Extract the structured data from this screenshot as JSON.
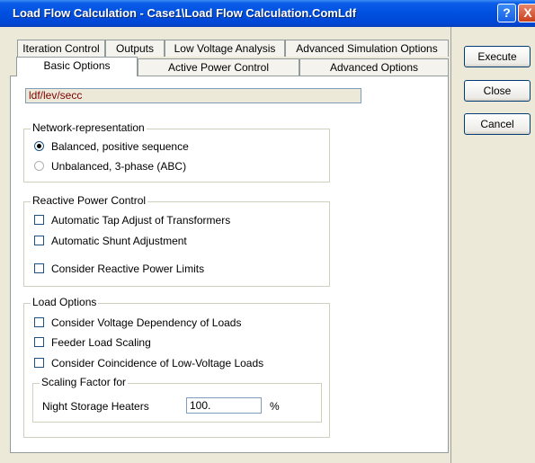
{
  "window": {
    "title": "Load Flow Calculation - Case1\\Load Flow Calculation.ComLdf",
    "help_glyph": "?",
    "close_glyph": "X"
  },
  "tabs": {
    "row_back": [
      "Iteration Control",
      "Outputs",
      "Low Voltage Analysis",
      "Advanced Simulation Options"
    ],
    "row_front": [
      "Basic Options",
      "Active Power Control",
      "Advanced Options"
    ],
    "active": "Basic Options"
  },
  "path_value": "ldf/lev/secc",
  "network": {
    "legend": "Network-representation",
    "options": [
      {
        "label": "Balanced, positive sequence",
        "selected": true
      },
      {
        "label": "Unbalanced, 3-phase (ABC)",
        "selected": false
      }
    ]
  },
  "reactive": {
    "legend": "Reactive Power Control",
    "checks": [
      {
        "label": "Automatic Tap Adjust of Transformers",
        "checked": false
      },
      {
        "label": "Automatic Shunt Adjustment",
        "checked": false
      },
      {
        "label": "Consider Reactive Power Limits",
        "checked": false
      }
    ]
  },
  "load": {
    "legend": "Load Options",
    "checks": [
      {
        "label": "Consider Voltage Dependency of Loads",
        "checked": false
      },
      {
        "label": "Feeder Load Scaling",
        "checked": false
      },
      {
        "label": "Consider Coincidence of Low-Voltage Loads",
        "checked": false
      }
    ],
    "scaling": {
      "legend": "Scaling Factor for",
      "label": "Night Storage Heaters",
      "value": "100.",
      "unit": "%"
    }
  },
  "buttons": {
    "execute": "Execute",
    "close": "Close",
    "cancel": "Cancel"
  }
}
